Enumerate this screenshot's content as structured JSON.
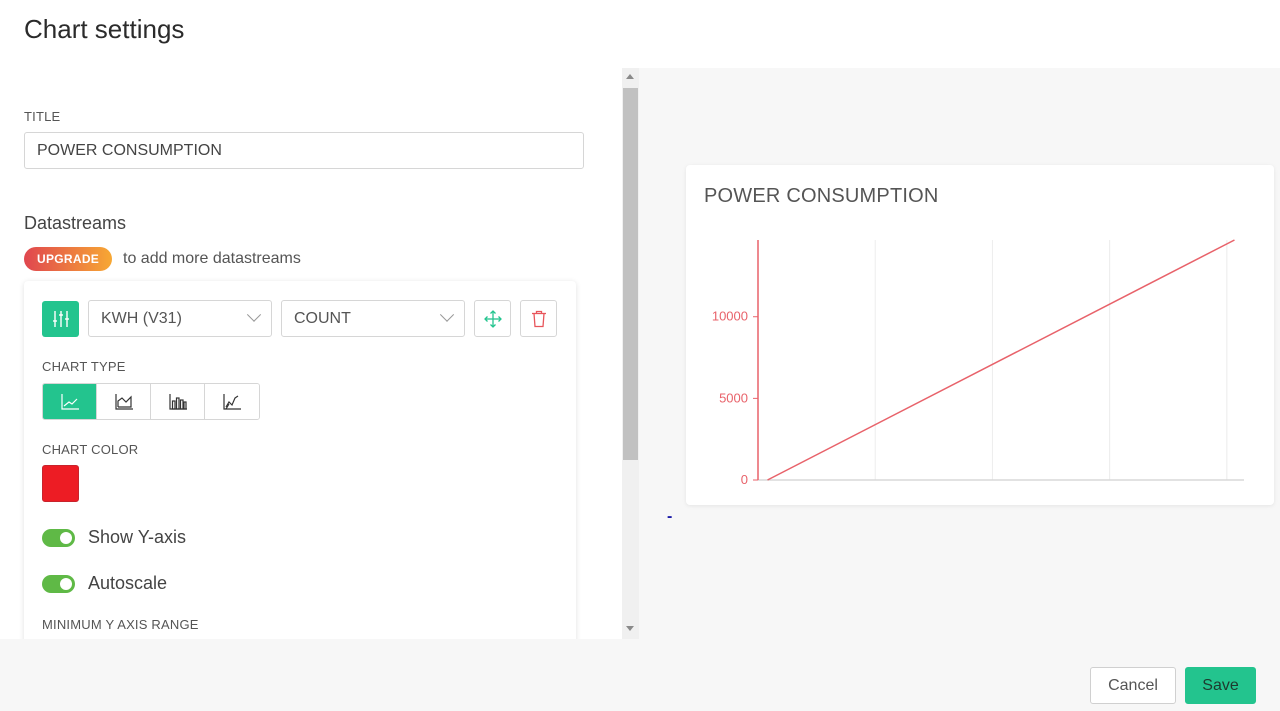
{
  "page": {
    "title": "Chart settings"
  },
  "form": {
    "title_label": "TITLE",
    "title_value": "POWER CONSUMPTION",
    "datastreams_heading": "Datastreams",
    "upgrade_badge": "UPGRADE",
    "upgrade_text": "to add more datastreams"
  },
  "datastream": {
    "source_value": "KWH (V31)",
    "aggregation_value": "COUNT",
    "chart_type_label": "CHART TYPE",
    "chart_types": [
      "line",
      "area",
      "bar",
      "binary"
    ],
    "active_chart_type": "line",
    "chart_color_label": "CHART COLOR",
    "chart_color": "#ed1c24",
    "toggles": [
      {
        "label": "Show Y-axis",
        "on": true
      },
      {
        "label": "Autoscale",
        "on": true
      }
    ],
    "min_range_label": "MINIMUM Y AXIS RANGE"
  },
  "colors": {
    "accent": "#23c48e",
    "toggle_on": "#5fb946",
    "delete": "#e8555b",
    "line": "#e8626a"
  },
  "preview": {
    "chart_title": "POWER CONSUMPTION",
    "marker": "-"
  },
  "chart_data": {
    "type": "line",
    "title": "POWER CONSUMPTION",
    "xlabel": "",
    "ylabel": "",
    "y_ticks": [
      0,
      5000,
      10000
    ],
    "ylim": [
      0,
      14700
    ],
    "grid": "vertical",
    "series": [
      {
        "x": [
          0.1,
          5.0
        ],
        "values": [
          0,
          14700
        ]
      }
    ],
    "xlim": [
      0,
      5.1
    ]
  },
  "footer": {
    "cancel_label": "Cancel",
    "save_label": "Save"
  }
}
